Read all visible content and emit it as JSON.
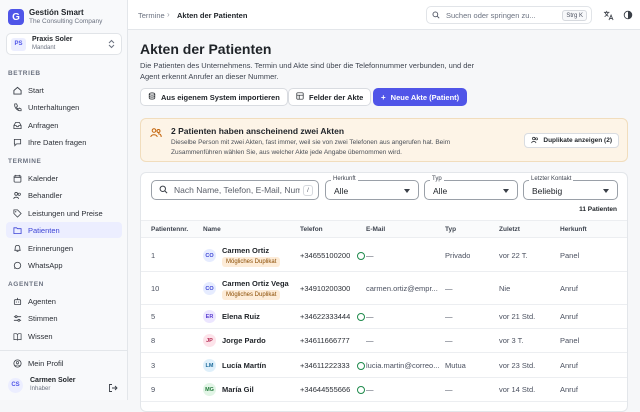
{
  "app": {
    "name": "Gestión Smart",
    "subtitle": "The Consulting Company",
    "logo_letter": "G"
  },
  "tenant": {
    "initials": "PS",
    "name": "Praxis Soler",
    "role": "Mandant"
  },
  "sidebar": {
    "sections": [
      {
        "label": "BETRIEB",
        "items": [
          {
            "label": "Start",
            "icon": "home-icon"
          },
          {
            "label": "Unterhaltungen",
            "icon": "phone-icon"
          },
          {
            "label": "Anfragen",
            "icon": "inbox-icon"
          },
          {
            "label": "Ihre Daten fragen",
            "icon": "chat-icon"
          }
        ]
      },
      {
        "label": "TERMINE",
        "items": [
          {
            "label": "Kalender",
            "icon": "calendar-icon"
          },
          {
            "label": "Behandler",
            "icon": "users-icon"
          },
          {
            "label": "Leistungen und Preise",
            "icon": "tag-icon"
          },
          {
            "label": "Patienten",
            "icon": "folder-icon",
            "active": true
          },
          {
            "label": "Erinnerungen",
            "icon": "bell-icon"
          },
          {
            "label": "WhatsApp",
            "icon": "whatsapp-icon"
          }
        ]
      },
      {
        "label": "AGENTEN",
        "items": [
          {
            "label": "Agenten",
            "icon": "bot-icon"
          },
          {
            "label": "Stimmen",
            "icon": "sliders-icon"
          },
          {
            "label": "Wissen",
            "icon": "book-icon"
          }
        ]
      }
    ],
    "profile_label": "Mein Profil",
    "user": {
      "initials": "CS",
      "name": "Carmen Soler",
      "role": "Inhaber"
    }
  },
  "topbar": {
    "breadcrumb": [
      "Termine",
      "Akten der Patienten"
    ],
    "search_placeholder": "Suchen oder springen zu...",
    "search_shortcut": "Strg K"
  },
  "page": {
    "title": "Akten der Patienten",
    "description": "Die Patienten des Unternehmens. Termin und Akte sind über die Telefonnummer verbunden, und der Agent erkennt Anrufer an dieser Nummer.",
    "buttons": {
      "import": "Aus eigenem System importieren",
      "fields": "Felder der Akte",
      "new": "Neue Akte (Patient)"
    }
  },
  "alert": {
    "title": "2 Patienten haben anscheinend zwei Akten",
    "text": "Dieselbe Person mit zwei Akten, fast immer, weil sie von zwei Telefonen aus angerufen hat. Beim Zusammenführen wählen Sie, aus welcher Akte jede Angabe übernommen wird.",
    "button": "Duplikate anzeigen (2)"
  },
  "filters": {
    "search_placeholder": "Nach Name, Telefon, E-Mail, Nummer suchen",
    "search_shortcut": "/",
    "herkunft": {
      "label": "Herkunft",
      "value": "Alle"
    },
    "typ": {
      "label": "Typ",
      "value": "Alle"
    },
    "kontakt": {
      "label": "Letzter Kontakt",
      "value": "Beliebig"
    },
    "count": "11 Patienten"
  },
  "table": {
    "headers": [
      "Patientennr.",
      "Name",
      "Telefon",
      "E-Mail",
      "Typ",
      "Zuletzt",
      "Herkunft"
    ],
    "duplicate_label": "Mögliches Duplikat",
    "rows": [
      {
        "nr": "1",
        "initials": "CO",
        "name": "Carmen Ortiz",
        "duplicate": true,
        "phone": "+34655100200",
        "whatsapp": true,
        "email": "—",
        "type": "Privado",
        "last": "vor 22 T.",
        "origin": "Panel",
        "avatar_bg": "#e6ecff",
        "avatar_fg": "#3d44d6"
      },
      {
        "nr": "10",
        "initials": "CO",
        "name": "Carmen Ortiz Vega",
        "duplicate": true,
        "phone": "+34910200300",
        "whatsapp": false,
        "email": "carmen.ortiz@empr...",
        "type": "—",
        "last": "Nie",
        "origin": "Anruf",
        "avatar_bg": "#e6ecff",
        "avatar_fg": "#3d44d6"
      },
      {
        "nr": "5",
        "initials": "ER",
        "name": "Elena Ruiz",
        "duplicate": false,
        "phone": "+34622333444",
        "whatsapp": true,
        "email": "—",
        "type": "—",
        "last": "vor 21 Std.",
        "origin": "Anruf",
        "avatar_bg": "#ece6ff",
        "avatar_fg": "#5a3fd0"
      },
      {
        "nr": "8",
        "initials": "JP",
        "name": "Jorge Pardo",
        "duplicate": false,
        "phone": "+34611666777",
        "whatsapp": false,
        "email": "—",
        "type": "—",
        "last": "vor 3 T.",
        "origin": "Panel",
        "avatar_bg": "#fde3ea",
        "avatar_fg": "#b3264f"
      },
      {
        "nr": "3",
        "initials": "LM",
        "name": "Lucía Martín",
        "duplicate": false,
        "phone": "+34611222333",
        "whatsapp": true,
        "email": "lucia.martin@correo...",
        "type": "Mutua",
        "last": "vor 23 Std.",
        "origin": "Anruf",
        "avatar_bg": "#dff0fb",
        "avatar_fg": "#1c6a9a"
      },
      {
        "nr": "9",
        "initials": "MG",
        "name": "María Gil",
        "duplicate": false,
        "phone": "+34644555666",
        "whatsapp": true,
        "email": "—",
        "type": "—",
        "last": "vor 14 Std.",
        "origin": "Anruf",
        "avatar_bg": "#e2f5e6",
        "avatar_fg": "#22793a"
      }
    ]
  },
  "colors": {
    "accent": "#5055e8",
    "alert_bg": "#fdf4e7",
    "active_nav_bg": "#eceeff"
  }
}
